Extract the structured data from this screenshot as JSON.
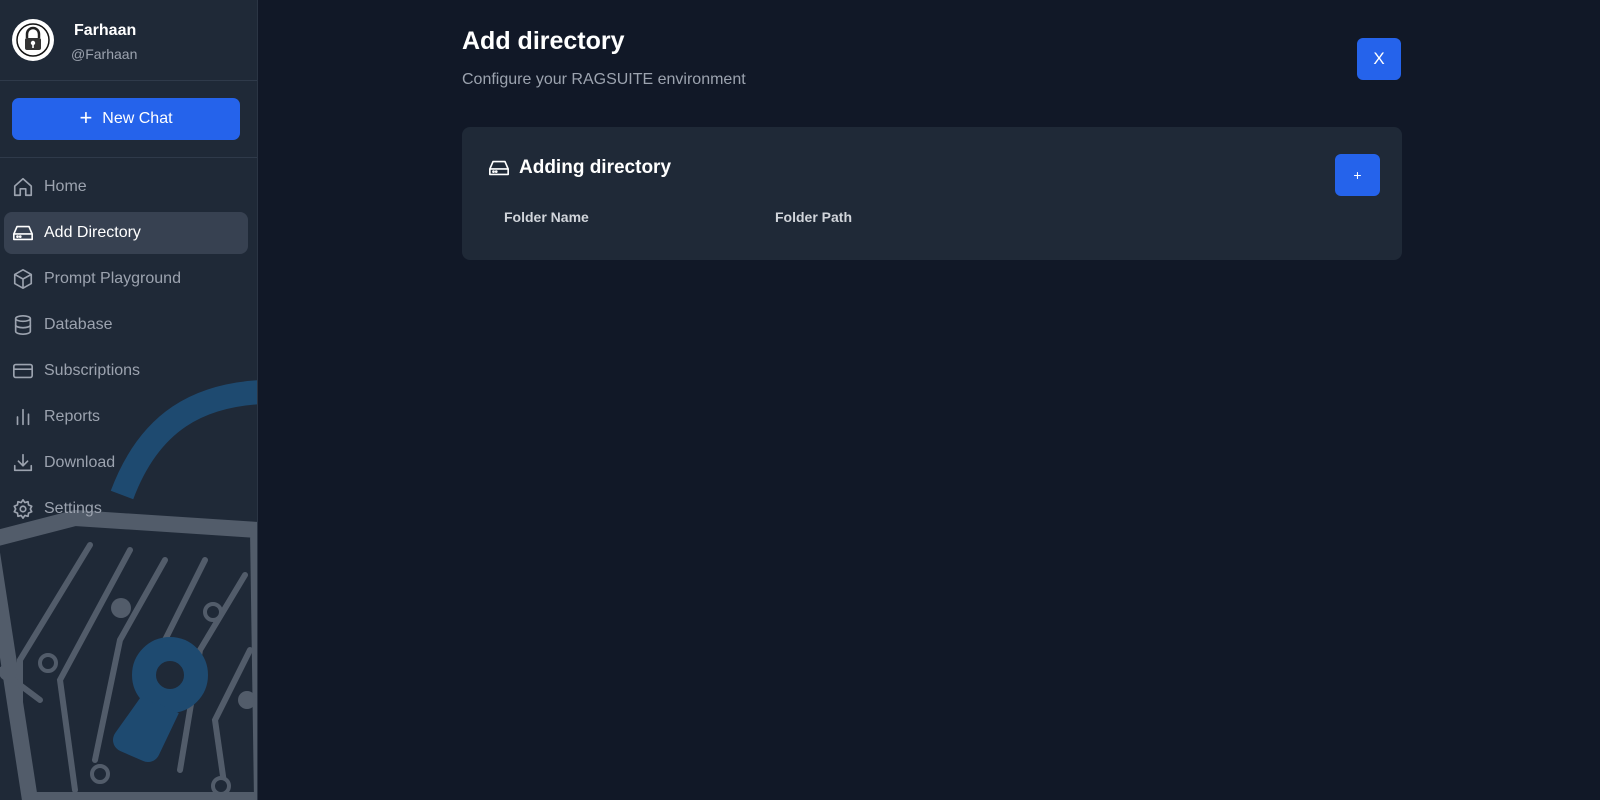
{
  "user": {
    "name": "Farhaan",
    "handle": "@Farhaan"
  },
  "sidebar": {
    "new_chat_label": "New Chat",
    "items": [
      {
        "label": "Home",
        "icon": "home-icon",
        "active": false
      },
      {
        "label": "Add Directory",
        "icon": "drive-icon",
        "active": true
      },
      {
        "label": "Prompt Playground",
        "icon": "cube-icon",
        "active": false
      },
      {
        "label": "Database",
        "icon": "database-icon",
        "active": false
      },
      {
        "label": "Subscriptions",
        "icon": "credit-card-icon",
        "active": false
      },
      {
        "label": "Reports",
        "icon": "bar-chart-icon",
        "active": false
      },
      {
        "label": "Download",
        "icon": "download-icon",
        "active": false
      },
      {
        "label": "Settings",
        "icon": "gear-icon",
        "active": false
      }
    ]
  },
  "main": {
    "title": "Add directory",
    "subtitle": "Configure your RAGSUITE environment",
    "close_label": "X",
    "card": {
      "title": "Adding directory",
      "add_label": "+",
      "columns": [
        "Folder Name",
        "Folder Path"
      ]
    }
  },
  "colors": {
    "background": "#111827",
    "sidebar": "#1f2937",
    "accent": "#2563eb",
    "active_item": "#374151",
    "muted_text": "#9ca3af"
  }
}
